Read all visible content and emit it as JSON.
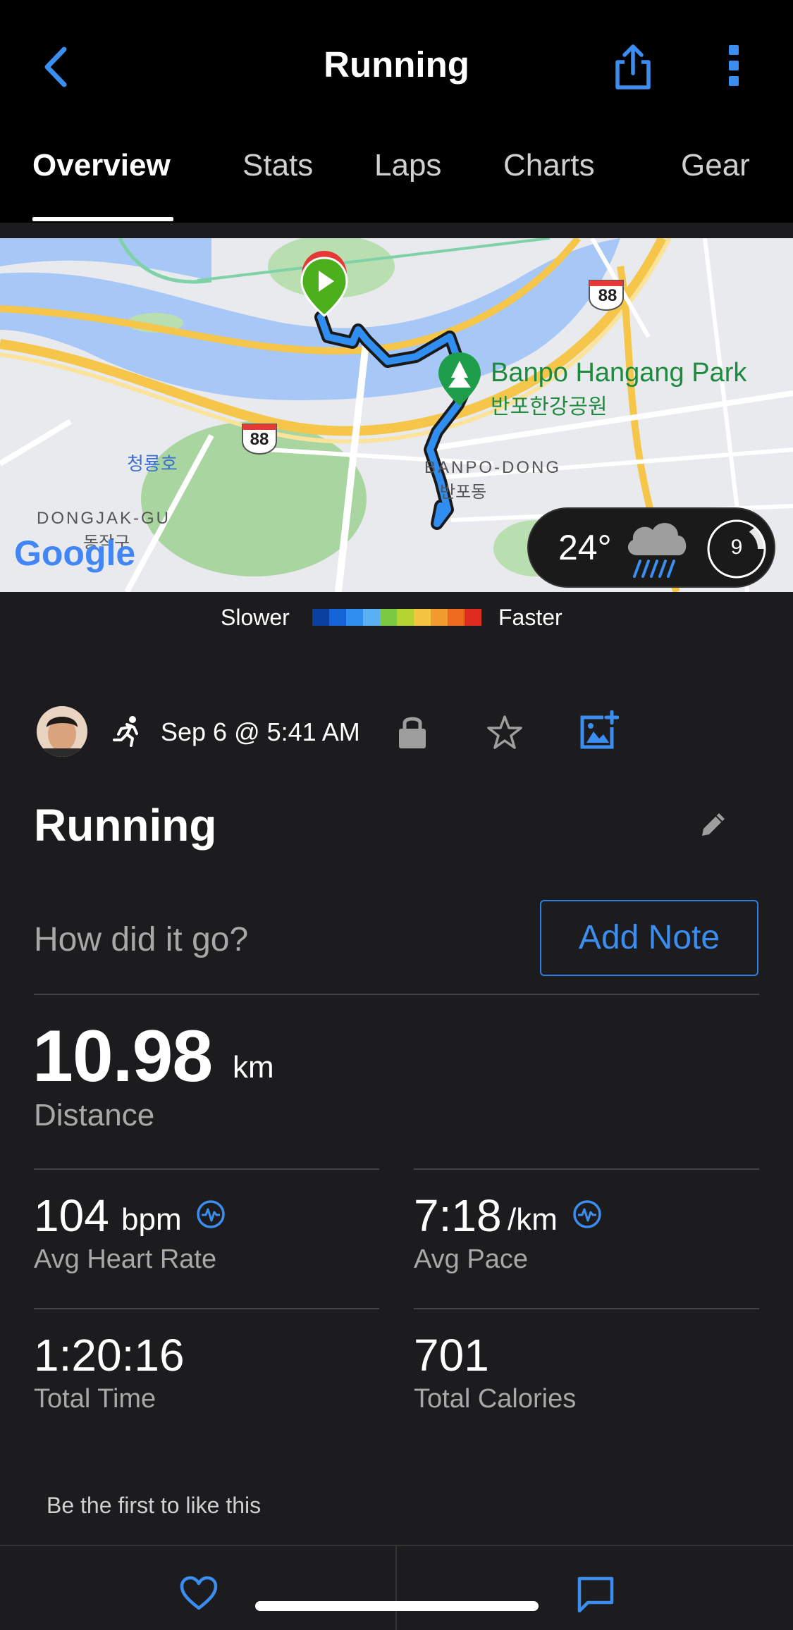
{
  "header": {
    "title": "Running",
    "icons": {
      "back": "chevron-left-icon",
      "share": "share-icon",
      "more": "more-vertical-icon"
    }
  },
  "tabs": [
    {
      "label": "Overview",
      "active": true
    },
    {
      "label": "Stats",
      "active": false
    },
    {
      "label": "Laps",
      "active": false
    },
    {
      "label": "Charts",
      "active": false
    },
    {
      "label": "Gear",
      "active": false
    }
  ],
  "map": {
    "labels": {
      "park_name": "Banpo Hangang Park",
      "park_name_ko": "반포한강공원",
      "district_1": "BANPO-DONG",
      "district_1_ko": "반포동",
      "district_2": "DONGJAK-GU",
      "district_2_ko": "동작구",
      "lake": "청룡호",
      "route_marker_1": "88",
      "route_marker_2": "88",
      "attribution": "Google"
    },
    "weather": {
      "temperature": "24°",
      "condition_icon": "rain-cloud-icon",
      "uv_index": "9"
    }
  },
  "legend": {
    "slower_label": "Slower",
    "faster_label": "Faster",
    "colors": [
      "#0b3fa0",
      "#1565d8",
      "#2f8ef0",
      "#5bb0f5",
      "#7ac943",
      "#b5d432",
      "#f5c542",
      "#f29a2e",
      "#ee6a1f",
      "#e02b20"
    ]
  },
  "activity": {
    "date": "Sep 6 @ 5:41 AM",
    "name": "Running",
    "note_prompt": "How did it go?",
    "add_note_label": "Add Note"
  },
  "stats": {
    "distance": {
      "value": "10.98",
      "unit": "km",
      "label": "Distance"
    },
    "avg_heart_rate": {
      "value": "104",
      "unit": "bpm",
      "label": "Avg Heart Rate"
    },
    "avg_pace": {
      "value": "7:18",
      "unit": "/km",
      "label": "Avg Pace"
    },
    "total_time": {
      "value": "1:20:16",
      "label": "Total Time"
    },
    "total_calories": {
      "value": "701",
      "label": "Total Calories"
    }
  },
  "social": {
    "likes_text": "Be the first to like this"
  },
  "colors": {
    "accent": "#3b8ef0",
    "background": "#1c1c1e",
    "header": "#000000"
  }
}
